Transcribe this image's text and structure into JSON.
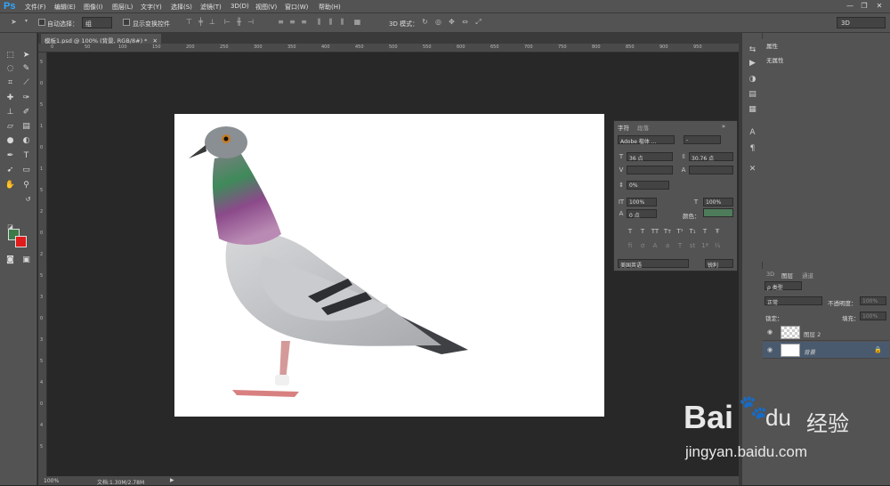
{
  "app": {
    "logo": "Ps"
  },
  "menu": [
    "文件(F)",
    "编辑(E)",
    "图像(I)",
    "图层(L)",
    "文字(Y)",
    "选择(S)",
    "滤镜(T)",
    "3D(D)",
    "视图(V)",
    "窗口(W)",
    "帮助(H)"
  ],
  "window_buttons": [
    "—",
    "❐",
    "✕"
  ],
  "options": {
    "auto_select_label": "自动选择：",
    "auto_select_value": "组",
    "show_transform_label": "显示变换控件",
    "mode_3d_label": "3D 模式：",
    "workspace": "3D"
  },
  "document": {
    "tab_title": "模板1.psd @ 100% (背景, RGB/8#) *",
    "zoom": "100%",
    "doc_info": "文档:1.30M/2.78M"
  },
  "ruler_top": [
    "0",
    "50",
    "100",
    "150",
    "200",
    "250",
    "300",
    "350",
    "400",
    "450",
    "500",
    "550",
    "600",
    "650",
    "700",
    "750",
    "800",
    "850",
    "900",
    "950"
  ],
  "ruler_left": [
    "5",
    "0",
    "5",
    "1",
    "0",
    "1",
    "5",
    "2",
    "0",
    "2",
    "5",
    "3",
    "0",
    "3",
    "5",
    "4",
    "0",
    "4",
    "5"
  ],
  "properties": {
    "tab": "属性",
    "empty": "无属性"
  },
  "character": {
    "tab_char": "字符",
    "tab_para": "段落",
    "font_family": "Adobe 楷体 ...",
    "font_style": "-",
    "size": "36 点",
    "leading": "30.76 点",
    "scale": "0%",
    "vscale": "100%",
    "hscale": "100%",
    "baseline": "0 点",
    "color_label": "颜色：",
    "color": "#4e7c5a",
    "language": "美国英语",
    "aa": "锐利"
  },
  "layers": {
    "tab_3d": "3D",
    "tab_layers": "图层",
    "tab_channels": "通道",
    "filter": "ρ 类型",
    "blend": "正常",
    "opacity_label": "不透明度：",
    "opacity": "100%",
    "lock_label": "锁定：",
    "fill_label": "填充：",
    "fill": "100%",
    "items": [
      {
        "name": "图层 2"
      },
      {
        "name": "背景"
      }
    ]
  },
  "watermark": {
    "brand_left": "Bai",
    "brand_right": "du",
    "brand_cn": "经验",
    "url": "jingyan.baidu.com"
  }
}
